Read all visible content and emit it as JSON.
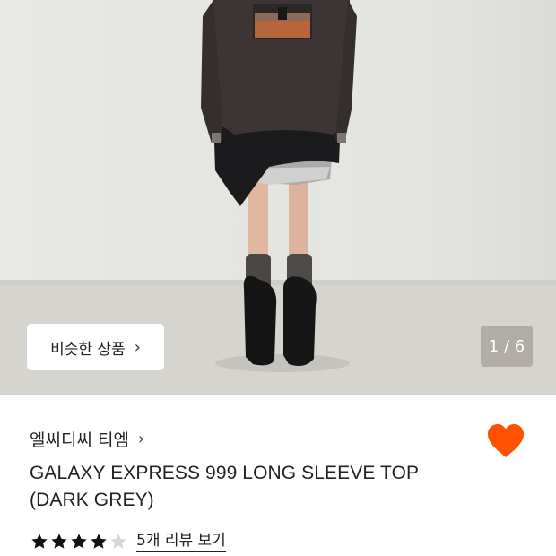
{
  "gallery": {
    "similar_button_label": "비슷한 상품",
    "page_counter": "1 / 6",
    "current_index": 1,
    "total_images": 6
  },
  "product": {
    "brand": "엘씨디씨 티엠",
    "title_line1": "GALAXY EXPRESS 999 LONG SLEEVE TOP",
    "title_line2": "(DARK GREY)",
    "rating": 4,
    "rating_max": 5,
    "review_link": "5개 리뷰 보기",
    "wishlisted": true
  },
  "icons": {
    "similar_chevron": "chevron-right-icon",
    "brand_chevron": "chevron-right-icon",
    "wishlist": "heart-icon",
    "star": "star-icon"
  },
  "colors": {
    "heart": "#ff5100",
    "star_filled": "#111111",
    "star_empty": "#d6d6d6",
    "counter_bg": "rgba(110,100,90,0.35)"
  }
}
